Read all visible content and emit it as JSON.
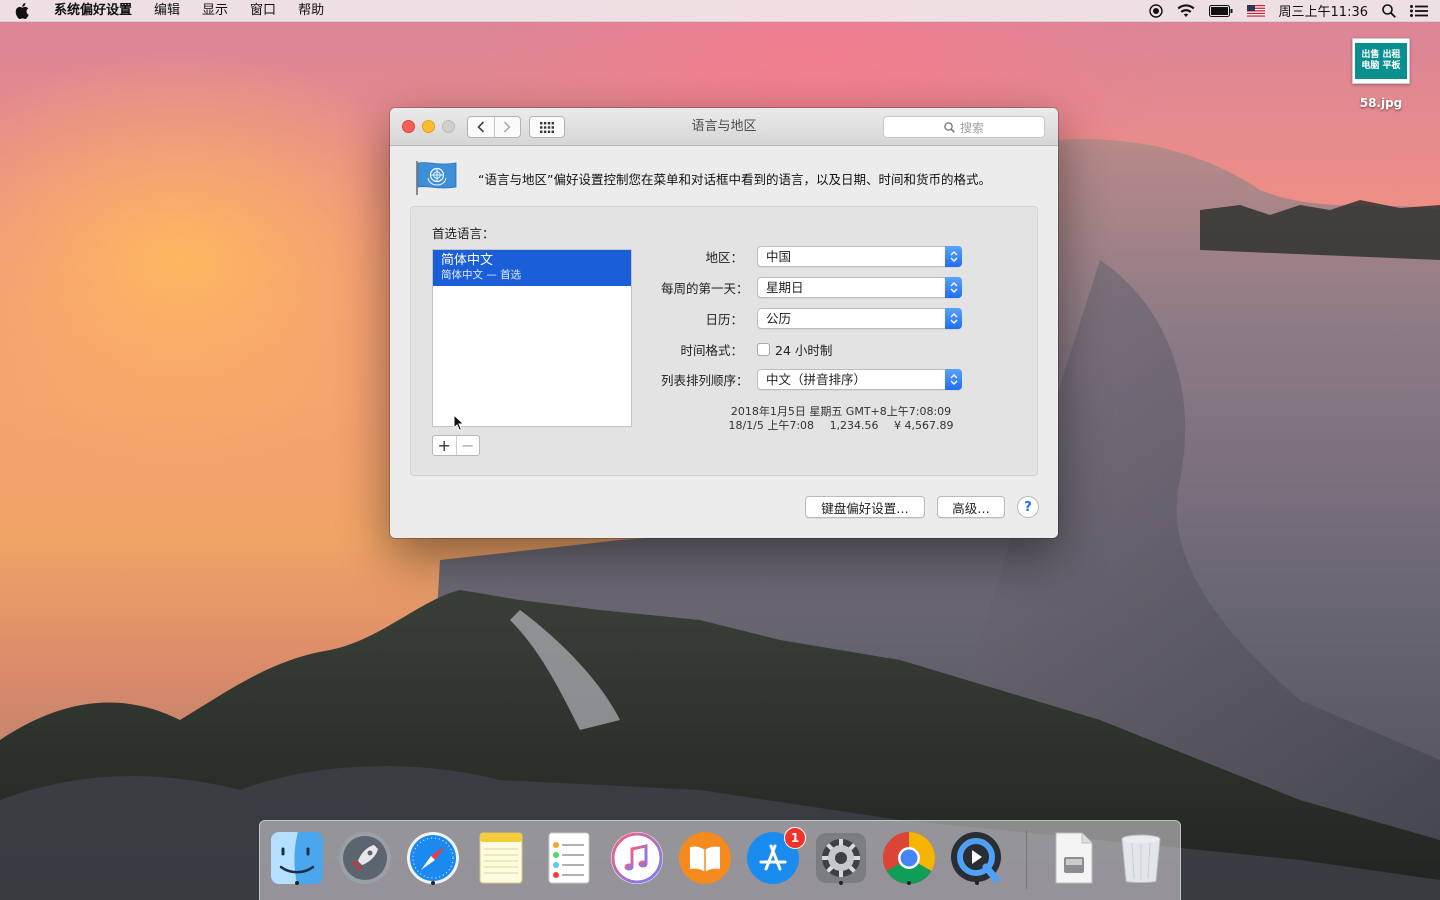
{
  "menubar": {
    "app_name": "系统偏好设置",
    "items": [
      "编辑",
      "显示",
      "窗口",
      "帮助"
    ],
    "clock": "周三上午11:36"
  },
  "desktop": {
    "file_name": "58.jpg",
    "thumb_lines": [
      "出售 出租",
      "电脑 平板"
    ]
  },
  "window": {
    "title": "语言与地区",
    "search_placeholder": "搜索",
    "description": "“语言与地区”偏好设置控制您在菜单和对话框中看到的语言，以及日期、时间和货币的格式。",
    "preferred_languages_label": "首选语言：",
    "languages": [
      {
        "name": "简体中文",
        "detail": "简体中文 — 首选"
      }
    ],
    "add_label": "+",
    "remove_label": "−",
    "region_label": "地区：",
    "region_value": "中国",
    "first_day_label": "每周的第一天：",
    "first_day_value": "星期日",
    "calendar_label": "日历：",
    "calendar_value": "公历",
    "time_format_label": "时间格式：",
    "time_format_checkbox": "24 小时制",
    "time_format_checked": false,
    "list_sort_label": "列表排列顺序：",
    "list_sort_value": "中文（拼音排序）",
    "sample_date": "2018年1月5日 星期五 GMT+8上午7:08:09",
    "sample_short": "18/1/5 上午7:08",
    "sample_number": "1,234.56",
    "sample_currency": "¥ 4,567.89",
    "keyboard_button": "键盘偏好设置…",
    "advanced_button": "高级…",
    "help_button": "?"
  },
  "dock": {
    "apps": [
      "Finder",
      "Launchpad",
      "Safari",
      "Notes",
      "Reminders",
      "iTunes",
      "iBooks",
      "App Store",
      "System Preferences",
      "Chrome",
      "QuickTime Player"
    ],
    "app_store_badge": "1",
    "extras": [
      "Downloads",
      "Trash"
    ]
  },
  "colors": {
    "selection": "#1a5fd8",
    "close": "#fc5f57",
    "minimize": "#fdbc2e",
    "badge": "#f4322a"
  }
}
